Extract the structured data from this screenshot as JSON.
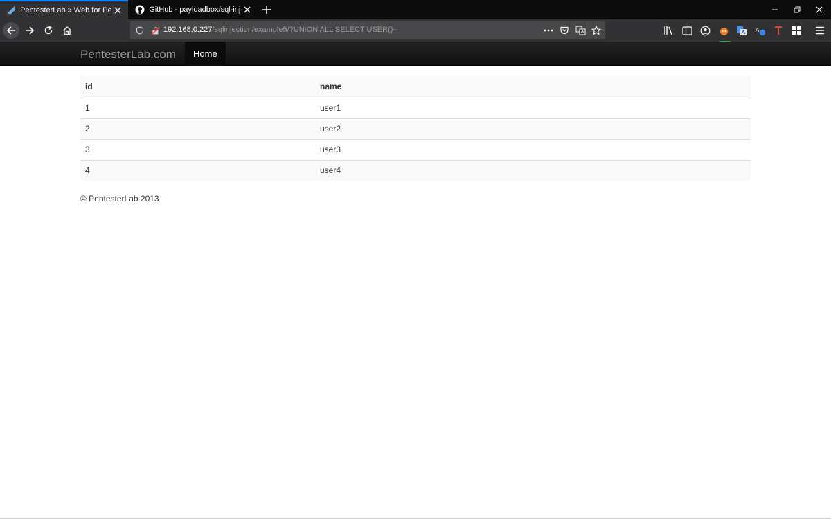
{
  "browser": {
    "tabs": [
      {
        "title": "PentesterLab » Web for Pentest",
        "active": true,
        "icon": "pentesterlab-favicon"
      },
      {
        "title": "GitHub - payloadbox/sql-injection",
        "active": false,
        "icon": "github-icon"
      }
    ],
    "url": {
      "host": "192.168.0.227",
      "path": "/sqlinjection/example5/?UNION ALL SELECT USER()--"
    },
    "badge": "local",
    "colors": {
      "accent": "#0a84ff",
      "chrome_dark": "#0c0c0d",
      "toolbar": "#323234"
    }
  },
  "site": {
    "brand": "PentesterLab.com",
    "nav": {
      "home_label": "Home"
    }
  },
  "table": {
    "headers": {
      "id": "id",
      "name": "name"
    },
    "rows": [
      {
        "id": "1",
        "name": "user1"
      },
      {
        "id": "2",
        "name": "user2"
      },
      {
        "id": "3",
        "name": "user3"
      },
      {
        "id": "4",
        "name": "user4"
      }
    ]
  },
  "footer": {
    "text": "© PentesterLab 2013"
  }
}
